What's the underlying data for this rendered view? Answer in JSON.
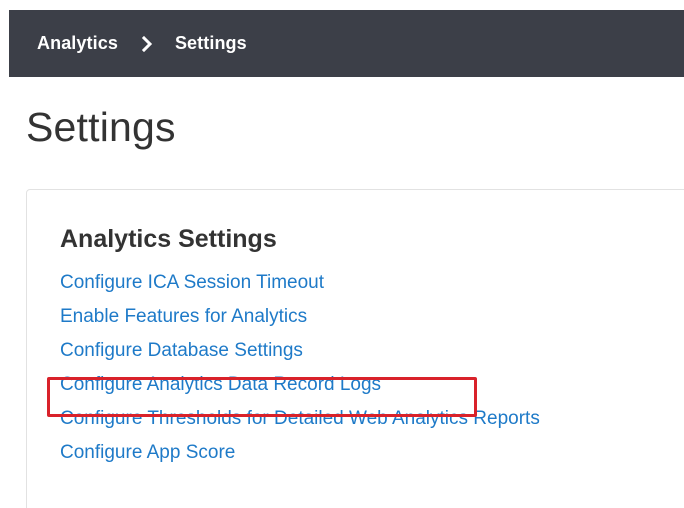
{
  "breadcrumb": {
    "items": [
      "Analytics",
      "Settings"
    ],
    "separator_icon": "chevron-right-icon"
  },
  "page": {
    "title": "Settings"
  },
  "card": {
    "title": "Analytics Settings",
    "links": [
      "Configure ICA Session Timeout",
      "Enable Features for Analytics",
      "Configure Database Settings",
      "Configure Analytics Data Record Logs",
      "Configure Thresholds for Detailed Web Analytics Reports",
      "Configure App Score"
    ],
    "highlighted_link": "Configure Analytics Data Record Logs",
    "highlight_color": "#d9222a"
  },
  "colors": {
    "topbar": "#3c3f48",
    "link": "#1e7ac8",
    "title": "#333333"
  }
}
